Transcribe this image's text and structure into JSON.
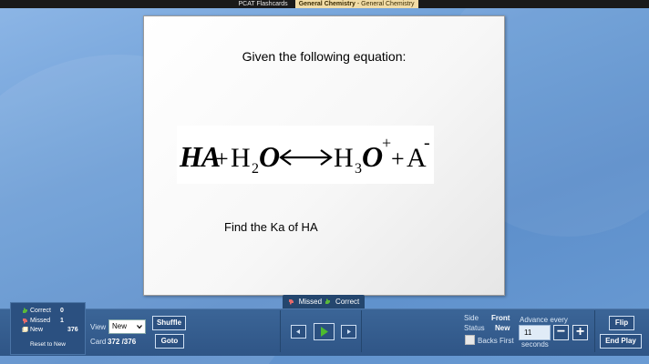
{
  "titlebar": {
    "app_title": "PCAT Flashcards",
    "tab_bold": "General Chemistry",
    "tab_rest": " - General Chemistry"
  },
  "card": {
    "prompt": "Given the following equation:",
    "equation_image_label": "HA + H2O ⟷ H3O+ + A-",
    "question": "Find the Ka of HA"
  },
  "tabs": {
    "missed": "Missed",
    "correct": "Correct"
  },
  "stats": {
    "correct_label": "Correct",
    "correct_value": "0",
    "missed_label": "Missed",
    "missed_value": "1",
    "new_label": "New",
    "new_value": "376",
    "reset_label": "Reset to New"
  },
  "view": {
    "label": "View",
    "selected": "New",
    "card_label": "Card",
    "card_value": "372 /376"
  },
  "buttons": {
    "shuffle": "Shuffle",
    "goto": "Goto",
    "flip": "Flip",
    "end_play": "End Play"
  },
  "status": {
    "side_label": "Side",
    "side_value": "Front",
    "status_label": "Status",
    "status_value": "New",
    "backs_first": "Backs First"
  },
  "advance": {
    "label": "Advance every",
    "value": "11",
    "unit": "seconds",
    "minus": "−",
    "plus": "+"
  },
  "colors": {
    "accent": "#2b5080",
    "play_green": "#4dbb2f",
    "thumb_green": "#5bb83a",
    "thumb_red": "#e36a6a"
  }
}
